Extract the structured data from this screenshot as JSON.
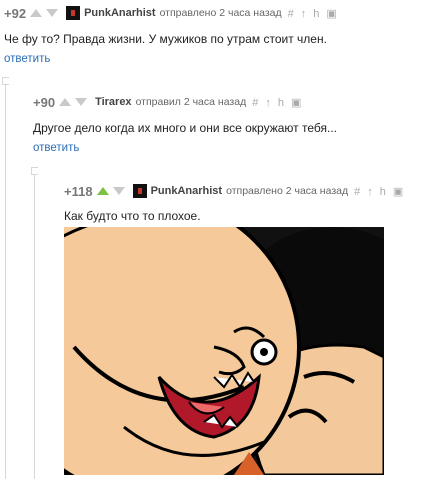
{
  "comments": [
    {
      "rating": "+92",
      "author": "PunkAnarhist",
      "meta": "отправлено 2 часа назад",
      "text": "Че фу то? Правда жизни. У мужиков по утрам стоит член.",
      "reply": "ответить"
    },
    {
      "rating": "+90",
      "author": "Tirarex",
      "meta": "отправил 2 часа назад",
      "text": "Другое дело когда их много и они все окружают тебя...",
      "reply": "ответить"
    },
    {
      "rating": "+118",
      "author": "PunkAnarhist",
      "meta": "отправлено 2 часа назад",
      "text": "Как будто что то плохое."
    }
  ],
  "tools": [
    "#",
    "↑",
    "h",
    "save"
  ],
  "colors": {
    "upvote_active": "#7cc142",
    "link": "#2b6db3"
  }
}
